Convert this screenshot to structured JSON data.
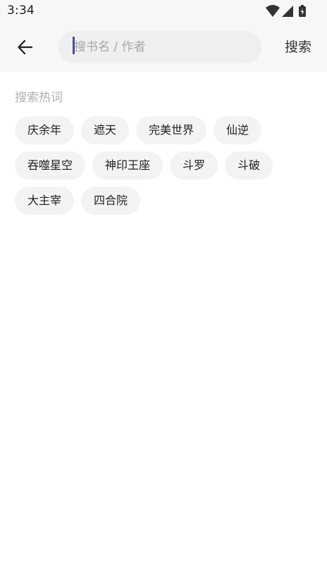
{
  "status_bar": {
    "time": "3:34",
    "icons": [
      "wifi-icon",
      "cellular-signal-icon",
      "battery-charging-icon"
    ]
  },
  "header": {
    "back_icon": "arrow-left-icon",
    "search": {
      "value": "",
      "placeholder": "搜书名 / 作者"
    },
    "search_label": "搜索"
  },
  "hot_words": {
    "title": "搜索热词",
    "rows": [
      [
        "庆余年",
        "遮天",
        "完美世界",
        "仙逆"
      ],
      [
        "吞噬星空",
        "神印王座",
        "斗罗",
        "斗破"
      ],
      [
        "大主宰",
        "四合院"
      ]
    ]
  },
  "colors": {
    "header_bg": "#f7f7f7",
    "search_field_bg": "#efefef",
    "chip_bg": "#f3f3f3",
    "caret": "#4a4e96",
    "muted_text": "#b0b0b0"
  }
}
